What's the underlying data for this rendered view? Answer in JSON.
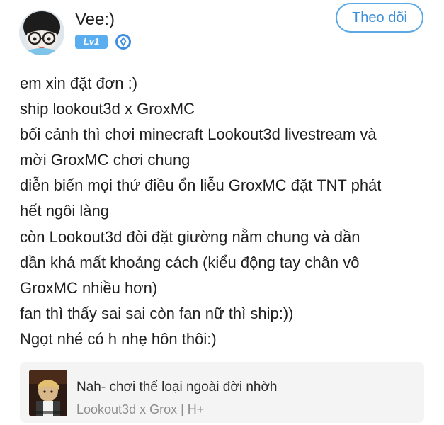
{
  "author": {
    "name": "Vee:)",
    "level_badge": "Lv1",
    "avatar_icon": "avatar-image",
    "verify_icon": "diamond-badge-icon",
    "badge_color": "#5aaef0"
  },
  "follow_button": {
    "label": "Theo dõi",
    "color": "#3d8fd8"
  },
  "post": {
    "lines": [
      "em xin đặt đơn :)",
      "ship lookout3d x GroxMC",
      "bối cảnh thì chơi minecraft Lookout3d livestream và",
      "mời GroxMC chơi chung",
      "diễn biến mọi thứ điều ổn liễu GroxMC đặt TNT phát",
      "hết ngôi làng",
      "còn Lookout3d đòi đặt giường nằm chung và dần",
      "dần khá mất khoảng cách (kiểu động tay chân vô",
      "GroxMC nhiều hơn)",
      "fan thì thấy sai sai còn fan nữ thì ship:))",
      "Ngọt nhé có h nhẹ hôn thôi:)"
    ]
  },
  "linked_card": {
    "title": "Nah- chơi thể loại ngoài đời nhờh",
    "subtitle": "Lookout3d x Grox | H+",
    "cover_icon": "book-cover-image",
    "background": "#f4f4f4"
  }
}
